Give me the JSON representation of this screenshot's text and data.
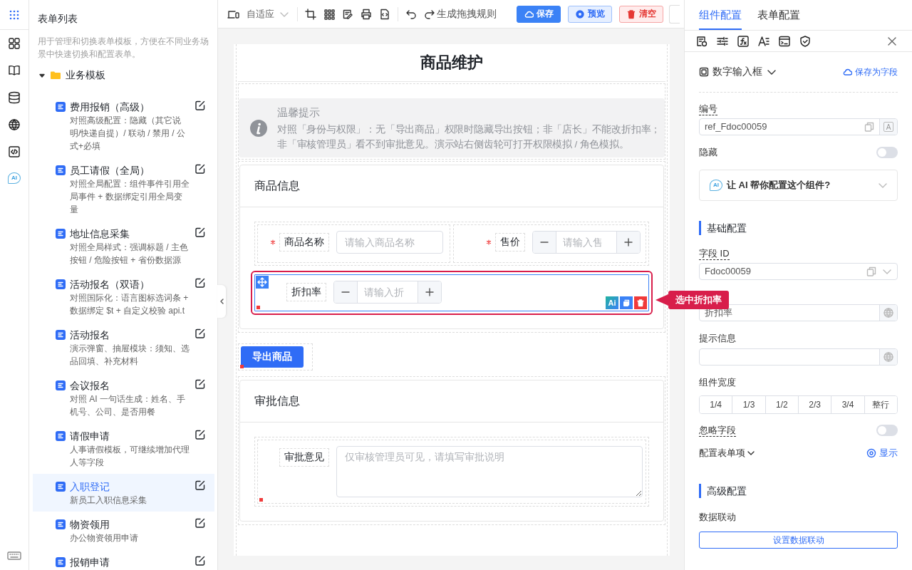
{
  "rail": {
    "ai_label": "AI"
  },
  "sidebar": {
    "title": "表单列表",
    "description": "用于管理和切换表单模板，方便在不同业务场景中快速切换和配置表单。",
    "tree": [
      {
        "label": "业务模板",
        "expanded": true,
        "children": [
          {
            "title": "费用报销（高级）",
            "description": "对照高级配置：隐藏（其它说明/快递自提）/ 联动 / 禁用 / 公式+必填",
            "selected": false
          },
          {
            "title": "员工请假（全局）",
            "description": "对照全局配置：组件事件引用全局事件 + 数据绑定引用全局变量",
            "selected": false
          },
          {
            "title": "地址信息采集",
            "description": "对照全局样式：强调标题 / 主色按钮 / 危险按钮 + 省份数据源",
            "selected": false
          },
          {
            "title": "活动报名（双语）",
            "description": "对照国际化：语言图标选词条 + 数据绑定 $t + 自定义校验 api.t",
            "selected": false
          },
          {
            "title": "活动报名",
            "description": "演示弹窗、抽屉模块：须知、选品回填、补充材料",
            "selected": false
          },
          {
            "title": "会议报名",
            "description": "对照 AI 一句话生成：姓名、手机号、公司、是否用餐",
            "selected": false
          },
          {
            "title": "请假申请",
            "description": "人事请假模板，可继续增加代理人等字段",
            "selected": false
          },
          {
            "title": "入职登记",
            "description": "新员工入职信息采集",
            "selected": true
          },
          {
            "title": "物资领用",
            "description": "办公物资领用申请",
            "selected": false
          },
          {
            "title": "报销申请",
            "selected": false
          }
        ]
      }
    ]
  },
  "toolbar": {
    "device_mode": "自适应",
    "rule_button": "生成拖拽规则",
    "buttons": [
      {
        "label": "保存",
        "kind": "primary"
      },
      {
        "label": "预览",
        "kind": "info"
      },
      {
        "label": "清空",
        "kind": "danger"
      }
    ]
  },
  "canvas": {
    "title": "商品维护",
    "notice": {
      "title": "温馨提示",
      "text": "对照「身份与权限」：无「导出商品」权限时隐藏导出按钮；非「店长」不能改折扣率；非「审核管理员」看不到审批意见。演示站右侧齿轮可打开权限模拟 / 角色模拟。"
    },
    "selection_ai_label": "Ai",
    "sections": [
      {
        "kind": "card",
        "title": "商品信息",
        "rows": [
          [
            {
              "label": "商品名称",
              "kind": "text",
              "required": true,
              "placeholder": "请输入商品名称",
              "selected": false
            },
            {
              "label": "售价",
              "kind": "number",
              "required": true,
              "placeholder": "请输入售",
              "selected": false
            }
          ],
          [
            {
              "label": "折扣率",
              "kind": "number",
              "required": false,
              "placeholder": "请输入折",
              "selected": true
            }
          ]
        ]
      },
      {
        "kind": "button",
        "label": "导出商品"
      },
      {
        "kind": "card",
        "title": "审批信息",
        "rows": [
          [
            {
              "label": "审批意见",
              "kind": "textarea",
              "required": false,
              "placeholder": "仅审核管理员可见，请填写审批说明",
              "selected": false
            }
          ]
        ]
      }
    ]
  },
  "callout": "选中折扣率",
  "settings": {
    "tabs": [
      {
        "label": "组件配置",
        "selected": true
      },
      {
        "label": "表单配置",
        "selected": false
      }
    ],
    "component_type": "数字输入框",
    "save_as_field": "保存为字段",
    "items": [
      {
        "kind": "input",
        "label": "编号",
        "has_tip": true,
        "value": "ref_Fdoc00059",
        "copy": true,
        "addon": "A"
      },
      {
        "kind": "switch",
        "label": "隐藏",
        "has_tip": false,
        "on": false
      },
      {
        "kind": "ai",
        "ai_label": "AI",
        "text": "让 AI 帮你配置这个组件?"
      },
      {
        "kind": "section",
        "title": "基础配置"
      },
      {
        "kind": "select",
        "label": "字段 ID",
        "has_tip": true,
        "value": "Fdoc00059",
        "copy": true
      },
      {
        "kind": "input",
        "value": "折扣率",
        "copy": false,
        "globe": true
      },
      {
        "kind": "input",
        "label": "提示信息",
        "has_tip": false,
        "copy": false,
        "globe": true
      },
      {
        "kind": "segmented",
        "label": "组件宽度",
        "options": [
          "1/4",
          "1/3",
          "1/2",
          "2/3",
          "3/4",
          "整行"
        ]
      },
      {
        "kind": "switch",
        "label": "忽略字段",
        "has_tip": true,
        "on": false
      },
      {
        "kind": "collapse",
        "label": "配置表单项",
        "action": "显示"
      },
      {
        "kind": "section",
        "title": "高级配置"
      },
      {
        "kind": "button",
        "label": "数据联动",
        "button": "设置数据联动"
      }
    ]
  }
}
